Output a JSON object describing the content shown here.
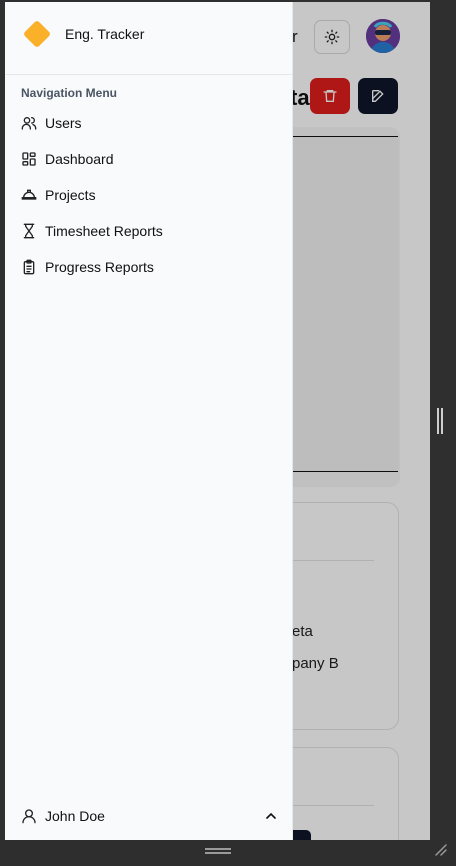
{
  "app": {
    "header_fragment": "r",
    "title_fragment": "ta",
    "card_line_1": "eta",
    "card_line_2": "pany B"
  },
  "drawer": {
    "brand_name": "Eng. Tracker",
    "nav_title": "Navigation Menu",
    "items": [
      {
        "label": "Users",
        "icon": "users-icon"
      },
      {
        "label": "Dashboard",
        "icon": "dashboard-icon"
      },
      {
        "label": "Projects",
        "icon": "hard-hat-icon"
      },
      {
        "label": "Timesheet Reports",
        "icon": "hourglass-icon"
      },
      {
        "label": "Progress Reports",
        "icon": "clipboard-icon"
      }
    ],
    "user": {
      "name": "John Doe",
      "icon": "user-icon"
    }
  },
  "colors": {
    "brand": "#fbb02a",
    "danger": "#e01e1e",
    "dark": "#0f172a",
    "drawer_bg": "#f8fafc"
  }
}
